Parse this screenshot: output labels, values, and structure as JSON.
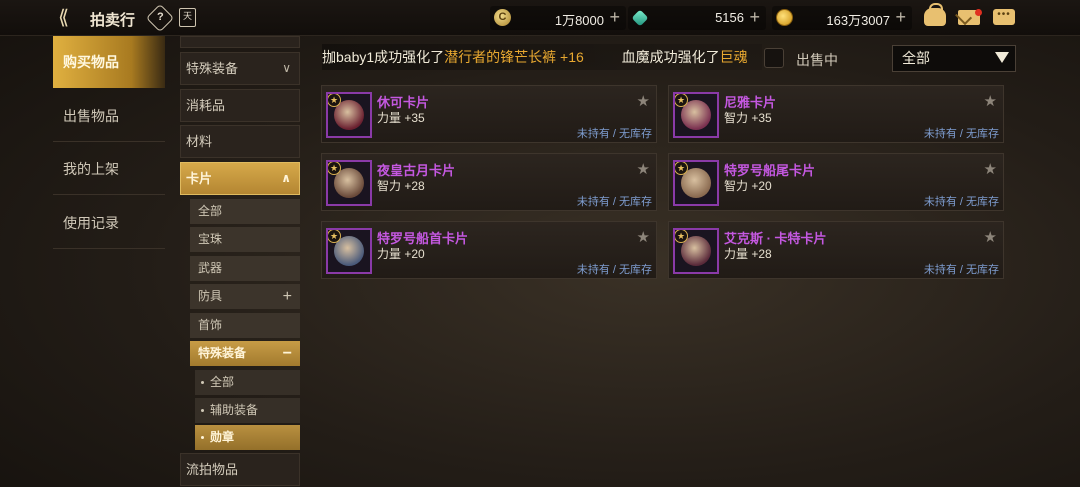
{
  "header": {
    "back_glyph": "⟪",
    "title": "拍卖行",
    "help_glyph": "?",
    "calendar_glyph": "天",
    "currencies": [
      {
        "name": "zeny",
        "icon": "zeny-coin-icon",
        "value": "1万8000",
        "coin_glyph": "C"
      },
      {
        "name": "gem",
        "icon": "gem-icon",
        "value": "5156"
      },
      {
        "name": "gold",
        "icon": "gold-coin-icon",
        "value": "163万3007"
      }
    ],
    "plus": "+",
    "chat_glyph": "•••"
  },
  "nav": {
    "items": [
      {
        "label": "购买物品",
        "active": true
      },
      {
        "label": "出售物品",
        "active": false
      },
      {
        "label": "我的上架",
        "active": false
      },
      {
        "label": "使用记录",
        "active": false
      }
    ]
  },
  "categories": {
    "top": [
      {
        "label": "特殊装备",
        "arrow": "∨"
      },
      {
        "label": "消耗品"
      },
      {
        "label": "材料"
      },
      {
        "label": "卡片",
        "arrow": "∧"
      }
    ],
    "sub": [
      {
        "label": "全部"
      },
      {
        "label": "宝珠"
      },
      {
        "label": "武器"
      },
      {
        "label": "防具",
        "sign": "+"
      },
      {
        "label": "首饰"
      },
      {
        "label": "特殊装备",
        "sign": "−"
      }
    ],
    "subsub": [
      {
        "label": "全部"
      },
      {
        "label": "辅助装备"
      },
      {
        "label": "勋章"
      }
    ],
    "bottom": {
      "label": "流拍物品"
    }
  },
  "ticker": {
    "part1": "拁baby1成功强化了",
    "item1": "潜行者的锋芒长裤 +16",
    "part2": "血魔成功强化了",
    "item2": "巨魂"
  },
  "filter": {
    "on_sale_label": "出售中",
    "dropdown_value": "全部"
  },
  "cards": [
    {
      "name": "休可卡片",
      "stat": "力量 +35",
      "status": "未持有 / 无库存",
      "art": "#6a2030"
    },
    {
      "name": "尼雅卡片",
      "stat": "智力 +35",
      "status": "未持有 / 无库存",
      "art": "#7a3050"
    },
    {
      "name": "夜皇古月卡片",
      "stat": "智力 +28",
      "status": "未持有 / 无库存",
      "art": "#6a4a3a"
    },
    {
      "name": "特罗号船尾卡片",
      "stat": "智力 +20",
      "status": "未持有 / 无库存",
      "art": "#8a6a50"
    },
    {
      "name": "特罗号船首卡片",
      "stat": "力量 +20",
      "status": "未持有 / 无库存",
      "art": "#4a5a7a"
    },
    {
      "name": "艾克斯 · 卡特卡片",
      "stat": "力量 +28",
      "status": "未持有 / 无库存",
      "art": "#5a2a3a"
    }
  ],
  "card_star_glyph": "★",
  "colors": {
    "accent_gold": "#d6a94a",
    "card_name": "#c458e0",
    "status_text": "#7e9dd0",
    "ticker_highlight": "#e8a830"
  }
}
